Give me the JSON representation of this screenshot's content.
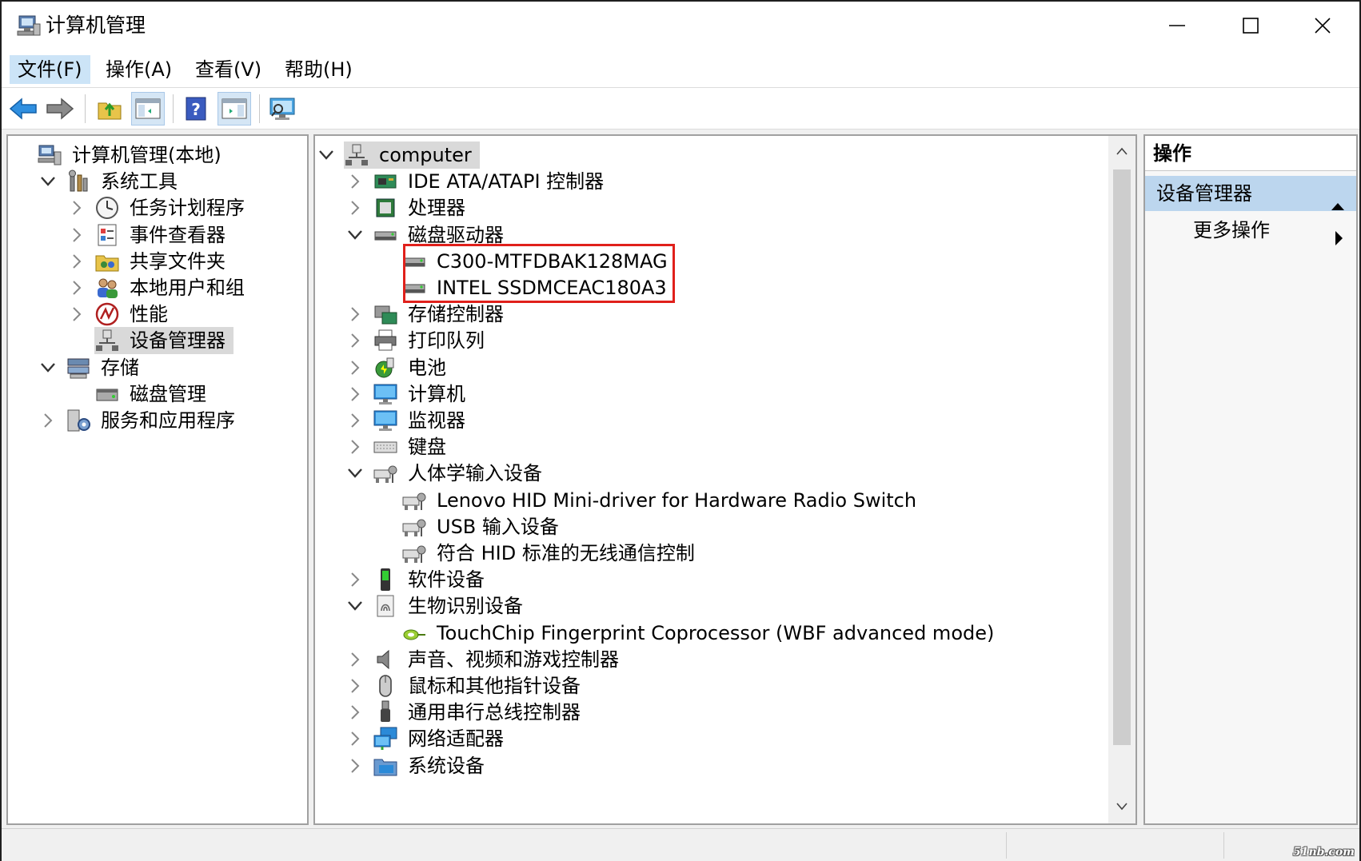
{
  "window": {
    "title": "计算机管理",
    "controls": {
      "minimize": "minimize",
      "maximize": "maximize",
      "close": "close"
    }
  },
  "menu": [
    {
      "label": "文件(F)",
      "active": true
    },
    {
      "label": "操作(A)",
      "active": false
    },
    {
      "label": "查看(V)",
      "active": false
    },
    {
      "label": "帮助(H)",
      "active": false
    }
  ],
  "toolbar": [
    {
      "name": "back-button",
      "icon": "back-arrow-icon"
    },
    {
      "name": "forward-button",
      "icon": "forward-arrow-icon"
    },
    {
      "name": "up-folder-button",
      "icon": "up-folder-icon"
    },
    {
      "name": "show-hide-console-tree-button",
      "icon": "console-tree-icon",
      "pressed": true
    },
    {
      "name": "help-button",
      "icon": "help-icon"
    },
    {
      "name": "show-hide-action-pane-button",
      "icon": "action-pane-icon",
      "pressed": true
    },
    {
      "name": "scan-hardware-button",
      "icon": "monitor-scan-icon"
    }
  ],
  "left_tree": [
    {
      "label": "计算机管理(本地)",
      "icon": "computer-management-icon",
      "level": 0,
      "chevron": "none"
    },
    {
      "label": "系统工具",
      "icon": "system-tools-icon",
      "level": 1,
      "chevron": "down"
    },
    {
      "label": "任务计划程序",
      "icon": "clock-icon",
      "level": 2,
      "chevron": "right"
    },
    {
      "label": "事件查看器",
      "icon": "event-viewer-icon",
      "level": 2,
      "chevron": "right"
    },
    {
      "label": "共享文件夹",
      "icon": "shared-folder-icon",
      "level": 2,
      "chevron": "right"
    },
    {
      "label": "本地用户和组",
      "icon": "users-icon",
      "level": 2,
      "chevron": "right"
    },
    {
      "label": "性能",
      "icon": "performance-icon",
      "level": 2,
      "chevron": "right"
    },
    {
      "label": "设备管理器",
      "icon": "device-manager-icon",
      "level": 2,
      "chevron": "none",
      "selected": true
    },
    {
      "label": "存储",
      "icon": "storage-icon",
      "level": 1,
      "chevron": "down"
    },
    {
      "label": "磁盘管理",
      "icon": "disk-management-icon",
      "level": 2,
      "chevron": "none"
    },
    {
      "label": "服务和应用程序",
      "icon": "services-icon",
      "level": 1,
      "chevron": "right"
    }
  ],
  "device_tree": [
    {
      "label": "computer",
      "icon": "computer-node-icon",
      "level": 0,
      "chevron": "down",
      "selected": true
    },
    {
      "label": "IDE ATA/ATAPI 控制器",
      "icon": "ide-controller-icon",
      "level": 1,
      "chevron": "right"
    },
    {
      "label": "处理器",
      "icon": "processor-icon",
      "level": 1,
      "chevron": "right"
    },
    {
      "label": "磁盘驱动器",
      "icon": "disk-drive-icon",
      "level": 1,
      "chevron": "down"
    },
    {
      "label": "C300-MTFDBAK128MAG",
      "icon": "disk-drive-icon",
      "level": 2,
      "chevron": "none"
    },
    {
      "label": "INTEL SSDMCEAC180A3",
      "icon": "disk-drive-icon",
      "level": 2,
      "chevron": "none"
    },
    {
      "label": "存储控制器",
      "icon": "storage-controller-icon",
      "level": 1,
      "chevron": "right"
    },
    {
      "label": "打印队列",
      "icon": "printer-icon",
      "level": 1,
      "chevron": "right"
    },
    {
      "label": "电池",
      "icon": "battery-icon",
      "level": 1,
      "chevron": "right"
    },
    {
      "label": "计算机",
      "icon": "monitor-icon",
      "level": 1,
      "chevron": "right"
    },
    {
      "label": "监视器",
      "icon": "monitor-icon",
      "level": 1,
      "chevron": "right"
    },
    {
      "label": "键盘",
      "icon": "keyboard-icon",
      "level": 1,
      "chevron": "right"
    },
    {
      "label": "人体学输入设备",
      "icon": "hid-icon",
      "level": 1,
      "chevron": "down"
    },
    {
      "label": "Lenovo HID Mini-driver for Hardware Radio Switch",
      "icon": "hid-icon",
      "level": 2,
      "chevron": "none"
    },
    {
      "label": "USB 输入设备",
      "icon": "hid-icon",
      "level": 2,
      "chevron": "none"
    },
    {
      "label": "符合 HID 标准的无线通信控制",
      "icon": "hid-icon",
      "level": 2,
      "chevron": "none"
    },
    {
      "label": "软件设备",
      "icon": "software-device-icon",
      "level": 1,
      "chevron": "right"
    },
    {
      "label": "生物识别设备",
      "icon": "biometric-icon",
      "level": 1,
      "chevron": "down"
    },
    {
      "label": "TouchChip Fingerprint Coprocessor (WBF advanced mode)",
      "icon": "fingerprint-icon",
      "level": 2,
      "chevron": "none"
    },
    {
      "label": "声音、视频和游戏控制器",
      "icon": "speaker-icon",
      "level": 1,
      "chevron": "right"
    },
    {
      "label": "鼠标和其他指针设备",
      "icon": "mouse-icon",
      "level": 1,
      "chevron": "right"
    },
    {
      "label": "通用串行总线控制器",
      "icon": "usb-icon",
      "level": 1,
      "chevron": "right"
    },
    {
      "label": "网络适配器",
      "icon": "network-adapter-icon",
      "level": 1,
      "chevron": "right"
    },
    {
      "label": "系统设备",
      "icon": "system-device-icon",
      "level": 1,
      "chevron": "right"
    }
  ],
  "actions": {
    "header": "操作",
    "section": "设备管理器",
    "more": "更多操作"
  },
  "watermark": "51nb.com",
  "colors": {
    "highlight_box": "#e0201b",
    "section_bg": "#bcd6ee",
    "menu_active": "#cce4f7",
    "selected_bg": "#d9d9d9"
  }
}
